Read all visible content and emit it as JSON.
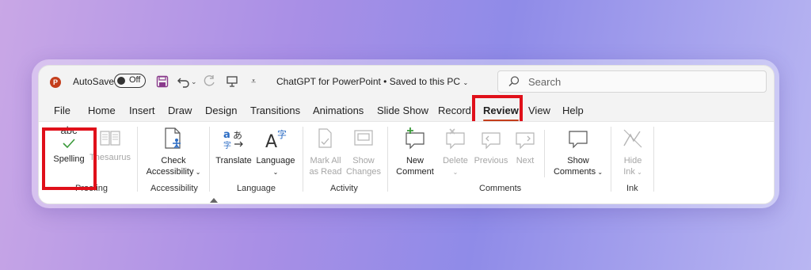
{
  "titlebar": {
    "app_logo_letter": "P",
    "autosave_label": "AutoSave",
    "autosave_toggle": "Off",
    "document_title": "ChatGPT for PowerPoint  •  Saved to this PC",
    "search_placeholder": "Search"
  },
  "menu_tabs": [
    "File",
    "Home",
    "Insert",
    "Draw",
    "Design",
    "Transitions",
    "Animations",
    "Slide Show",
    "Record",
    "Review",
    "View",
    "Help"
  ],
  "active_tab": "Review",
  "ribbon": {
    "proofing": {
      "label": "Proofing",
      "spelling_icon_text": "abc",
      "spelling": "Spelling",
      "thesaurus": "Thesaurus"
    },
    "accessibility": {
      "label": "Accessibility",
      "check_line1": "Check",
      "check_line2": "Accessibility"
    },
    "language": {
      "label": "Language",
      "translate": "Translate",
      "language_btn": "Language"
    },
    "activity": {
      "label": "Activity",
      "mark_all_line1": "Mark All",
      "mark_all_line2": "as Read",
      "show_changes_line1": "Show",
      "show_changes_line2": "Changes"
    },
    "comments": {
      "label": "Comments",
      "new_line1": "New",
      "new_line2": "Comment",
      "delete": "Delete",
      "previous": "Previous",
      "next": "Next",
      "show_line1": "Show",
      "show_line2": "Comments"
    },
    "ink": {
      "label": "Ink",
      "hide_line1": "Hide",
      "hide_line2": "Ink"
    }
  },
  "colors": {
    "accent": "#c43e1c",
    "highlight": "#e0101a",
    "check_green": "#3a9a3a"
  }
}
